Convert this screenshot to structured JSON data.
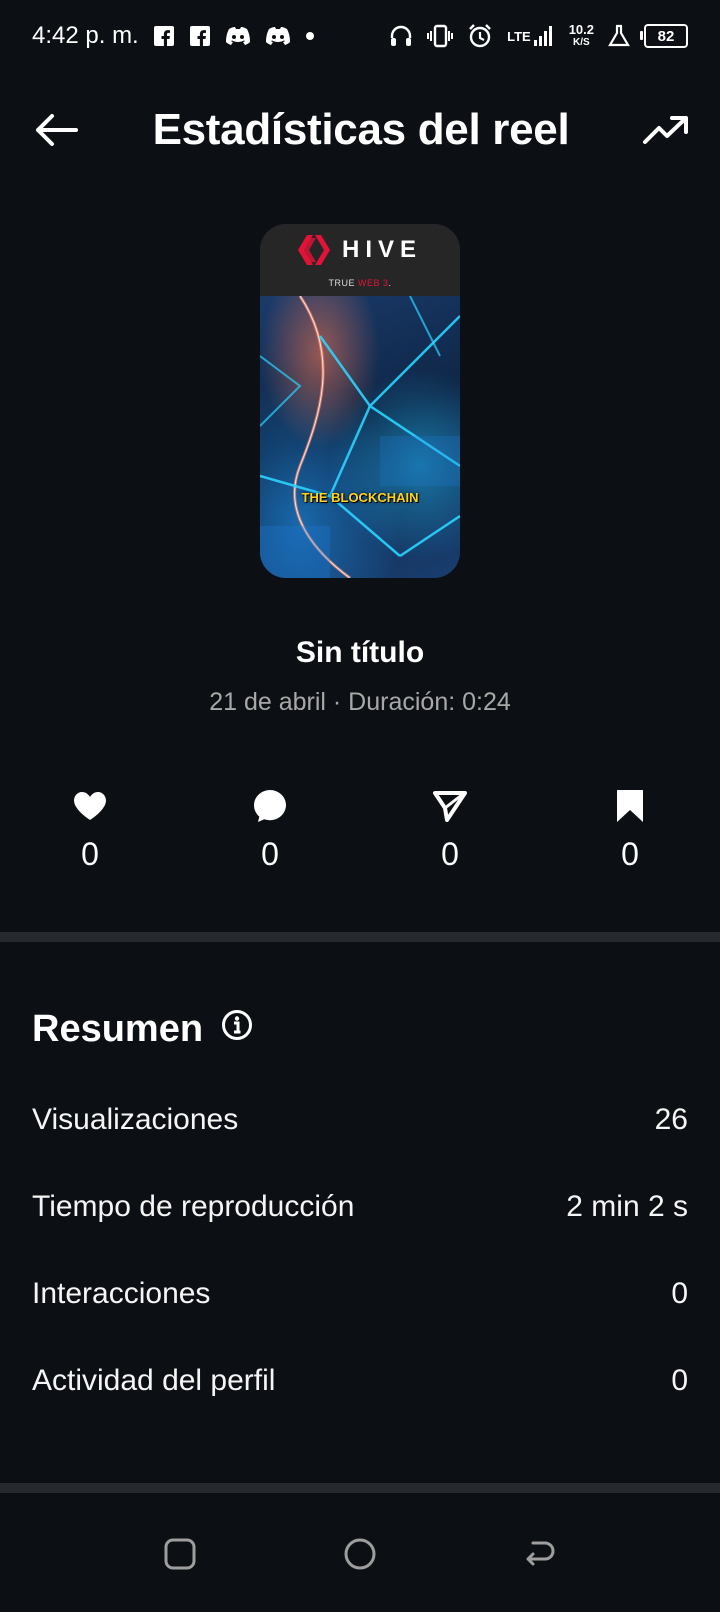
{
  "status_bar": {
    "time": "4:42 p. m.",
    "network_type": "LTE",
    "network_speed_value": "10.2",
    "network_speed_unit": "K/S",
    "battery_level": "82",
    "icons": [
      "facebook-icon",
      "facebook-icon",
      "discord-icon",
      "discord-icon",
      "dot-icon",
      "headphones-icon",
      "vibrate-icon",
      "alarm-icon",
      "lte-signal-icon",
      "lab-flask-icon",
      "battery-icon"
    ]
  },
  "header": {
    "title": "Estadísticas del reel",
    "back_icon": "arrow-left-icon",
    "trend_icon": "trending-up-icon"
  },
  "reel": {
    "thumbnail": {
      "brand": "HIVE",
      "tagline_prefix": "TRUE ",
      "tagline_highlight": "WEB 3",
      "tagline_suffix": ".",
      "caption": "THE BLOCKCHAIN",
      "brand_color": "#e31337"
    },
    "title": "Sin título",
    "meta": "21 de abril · Duración: 0:24"
  },
  "engagement": [
    {
      "icon": "heart-icon",
      "count": "0"
    },
    {
      "icon": "comment-icon",
      "count": "0"
    },
    {
      "icon": "share-icon",
      "count": "0"
    },
    {
      "icon": "bookmark-icon",
      "count": "0"
    }
  ],
  "summary": {
    "heading": "Resumen",
    "info_icon": "info-icon",
    "rows": [
      {
        "label": "Visualizaciones",
        "value": "26"
      },
      {
        "label": "Tiempo de reproducción",
        "value": "2 min 2 s"
      },
      {
        "label": "Interacciones",
        "value": "0"
      },
      {
        "label": "Actividad del perfil",
        "value": "0"
      }
    ]
  },
  "nav_bar": {
    "buttons": [
      "recent-apps-icon",
      "home-icon",
      "back-icon"
    ]
  },
  "colors": {
    "background": "#0c1014",
    "text_primary": "#f5f5f5",
    "text_secondary": "#a8a8a8",
    "divider": "#262a2f",
    "caption_yellow": "#ffd21f"
  }
}
